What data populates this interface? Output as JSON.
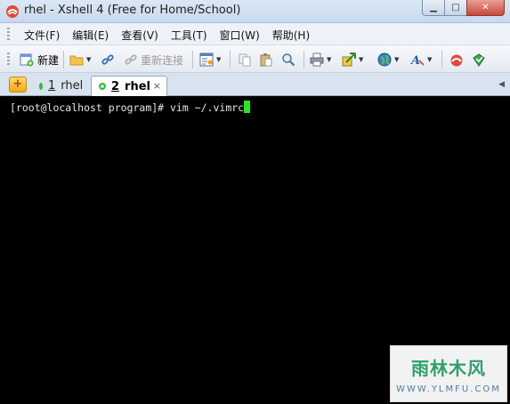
{
  "window": {
    "title": "rhel - Xshell 4 (Free for Home/School)",
    "minimize_glyph": "▁",
    "maximize_glyph": "□",
    "close_glyph": "✕"
  },
  "menu": [
    "文件(F)",
    "编辑(E)",
    "查看(V)",
    "工具(T)",
    "窗口(W)",
    "帮助(H)"
  ],
  "toolbar": {
    "new_label": "新建",
    "reconnect_label": "重新连接",
    "dropdown_glyph": "▼"
  },
  "tabs": {
    "new_tab_glyph": "+",
    "items": [
      {
        "number": "1",
        "label": "rhel"
      },
      {
        "number": "2",
        "label": "rhel"
      }
    ],
    "close_glyph": "×",
    "menu_glyph": "◀"
  },
  "terminal": {
    "line": "[root@localhost program]# vim ~/.vimrc"
  },
  "watermark": {
    "title": "雨林木风",
    "url": "WWW.YLMFU.COM"
  },
  "colors": {
    "cursor": "#29e629",
    "terminal_bg": "#000000",
    "tab_status_dot": "#3db83d"
  }
}
